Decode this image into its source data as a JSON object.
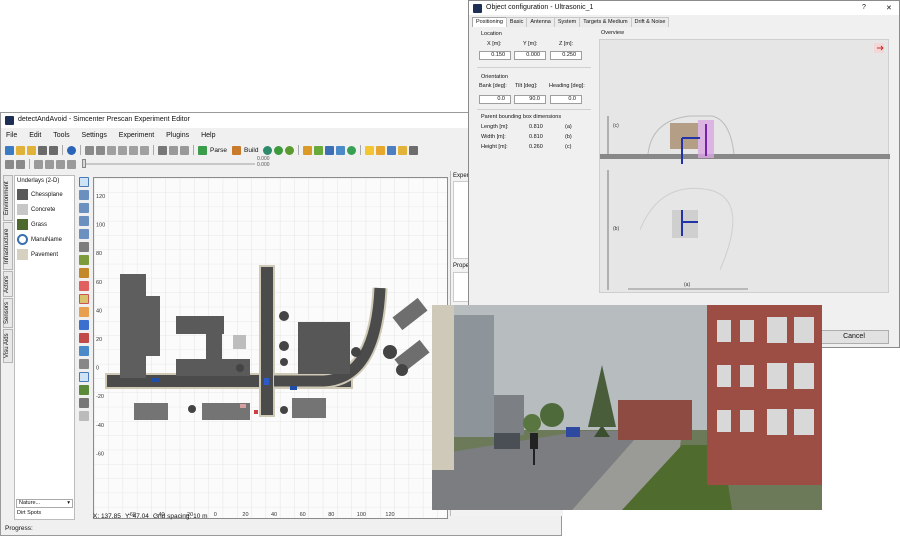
{
  "editor": {
    "title": "detectAndAvoid - Simcenter Prescan Experiment Editor",
    "menu": [
      "File",
      "Edit",
      "Tools",
      "Settings",
      "Experiment",
      "Plugins",
      "Help"
    ],
    "toolbar": {
      "parse_label": "Parse",
      "build_label": "Build"
    },
    "ruler_value_1": "0.000",
    "ruler_value_2": "0.000",
    "side_tabs": [
      "Environment",
      "Infrastructure",
      "Actors",
      "Sensors",
      "Visu Aids"
    ],
    "underlays_title": "Underlays (2-D)",
    "underlays": [
      {
        "label": "Chessplane",
        "icon": "chessplane-icon",
        "color": "#5a5a5a"
      },
      {
        "label": "Concrete",
        "icon": "concrete-icon",
        "color": "#c7c7c7"
      },
      {
        "label": "Grass",
        "icon": "grass-icon",
        "color": "#4c6a2e"
      },
      {
        "label": "ManuName",
        "icon": "eye-icon",
        "color": "#3a6fb0"
      },
      {
        "label": "Pavement",
        "icon": "pavement-icon",
        "color": "#d6d0c0"
      }
    ],
    "nature_dropdown": "Nature...",
    "dirt_spots": "Dirt Spots",
    "map": {
      "x_ticks": [
        "-60",
        "-40",
        "-20",
        "0",
        "20",
        "40",
        "60",
        "80",
        "100",
        "120"
      ],
      "y_ticks": [
        "120",
        "100",
        "80",
        "60",
        "40",
        "20",
        "0",
        "-20",
        "-40",
        "-60"
      ]
    },
    "right_panel": {
      "experiment_label": "Experime",
      "props_label": "Prope"
    },
    "status": {
      "x": "X: 137.85",
      "y": "Y: 47.04",
      "grid": "Grid spacing: 10 m",
      "progress": "Progress:"
    }
  },
  "dialog": {
    "title": "Object configuration - Ultrasonic_1",
    "help": "?",
    "close": "✕",
    "tabs": [
      "Positioning",
      "Basic",
      "Antenna",
      "System",
      "Targets & Medium",
      "Drift & Noise"
    ],
    "location_title": "Location",
    "location": [
      {
        "label": "X [m]:",
        "value": "0.150"
      },
      {
        "label": "Y [m]:",
        "value": "0.000"
      },
      {
        "label": "Z [m]:",
        "value": "0.250"
      }
    ],
    "orientation_title": "Orientation",
    "orientation": [
      {
        "label": "Bank [deg]:",
        "value": "0.0"
      },
      {
        "label": "Tilt [deg]:",
        "value": "90.0"
      },
      {
        "label": "Heading [deg]:",
        "value": "0.0"
      }
    ],
    "bbox_title": "Parent bounding box dimensions",
    "bbox": [
      {
        "label": "Length [m]:",
        "value": "0.810",
        "tag": "(a)"
      },
      {
        "label": "Width [m]:",
        "value": "0.810",
        "tag": "(b)"
      },
      {
        "label": "Height [m]:",
        "value": "0.260",
        "tag": "(c)"
      }
    ],
    "overview_title": "Overview",
    "overview_labels": {
      "c": "(c)",
      "b": "(b)",
      "a": "(a)"
    },
    "cancel_label": "Cancel"
  }
}
